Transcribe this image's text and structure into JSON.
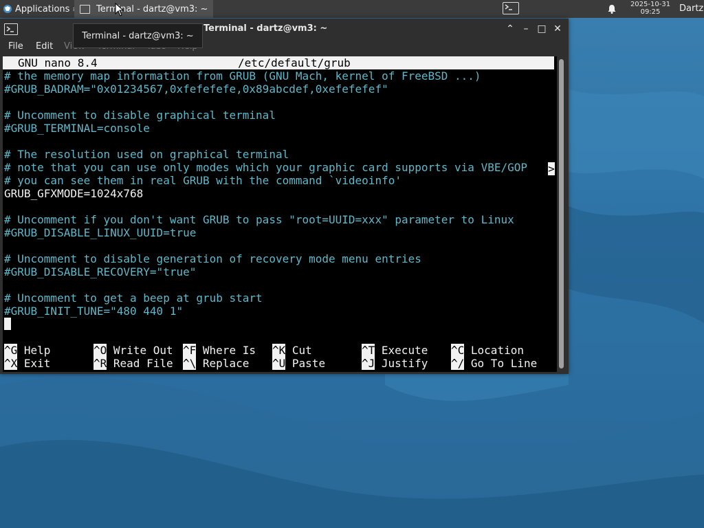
{
  "panel": {
    "applications_label": "Applications",
    "applications_arrow": "≡",
    "task_label": "Terminal - dartz@vm3: ~",
    "clock_date": "2025-10-31",
    "clock_time": "09:25",
    "user_label": "Dartz"
  },
  "tooltip": {
    "text": "Terminal - dartz@vm3: ~"
  },
  "window": {
    "title": "Terminal - dartz@vm3: ~",
    "buttons": {
      "shade": "⌃",
      "minimize": "–",
      "maximize": "□",
      "close": "✕"
    },
    "menu": [
      "File",
      "Edit",
      "View",
      "Terminal",
      "Tabs",
      "Help"
    ]
  },
  "nano": {
    "app_version": "GNU nano 8.4",
    "file_path": "/etc/default/grub",
    "overflow_marker": ">",
    "lines": [
      "# the memory map information from GRUB (GNU Mach, kernel of FreeBSD ...)",
      "#GRUB_BADRAM=\"0x01234567,0xfefefefe,0x89abcdef,0xefefefef\"",
      "",
      "# Uncomment to disable graphical terminal",
      "#GRUB_TERMINAL=console",
      "",
      "# The resolution used on graphical terminal",
      "# note that you can use only modes which your graphic card supports via VBE/GOP",
      "# you can see them in real GRUB with the command `videoinfo'",
      "GRUB_GFXMODE=1024x768",
      "",
      "# Uncomment if you don't want GRUB to pass \"root=UUID=xxx\" parameter to Linux",
      "#GRUB_DISABLE_LINUX_UUID=true",
      "",
      "# Uncomment to disable generation of recovery mode menu entries",
      "#GRUB_DISABLE_RECOVERY=\"true\"",
      "",
      "# Uncomment to get a beep at grub start",
      "#GRUB_INIT_TUNE=\"480 440 1\""
    ],
    "shortcuts_row1": [
      {
        "key": "^G",
        "label": "Help"
      },
      {
        "key": "^O",
        "label": "Write Out"
      },
      {
        "key": "^F",
        "label": "Where Is"
      },
      {
        "key": "^K",
        "label": "Cut"
      },
      {
        "key": "^T",
        "label": "Execute"
      },
      {
        "key": "^C",
        "label": "Location"
      }
    ],
    "shortcuts_row2": [
      {
        "key": "^X",
        "label": "Exit"
      },
      {
        "key": "^R",
        "label": "Read File"
      },
      {
        "key": "^\\",
        "label": "Replace"
      },
      {
        "key": "^U",
        "label": "Paste"
      },
      {
        "key": "^J",
        "label": "Justify"
      },
      {
        "key": "^/",
        "label": "Go To Line"
      }
    ]
  },
  "colors": {
    "comment": "#5fb8c9",
    "text": "#f2f2f2",
    "terminal_bg": "#000000",
    "panel_bg": "#3b3b3b",
    "desktop_bg": "#2e73a6"
  }
}
